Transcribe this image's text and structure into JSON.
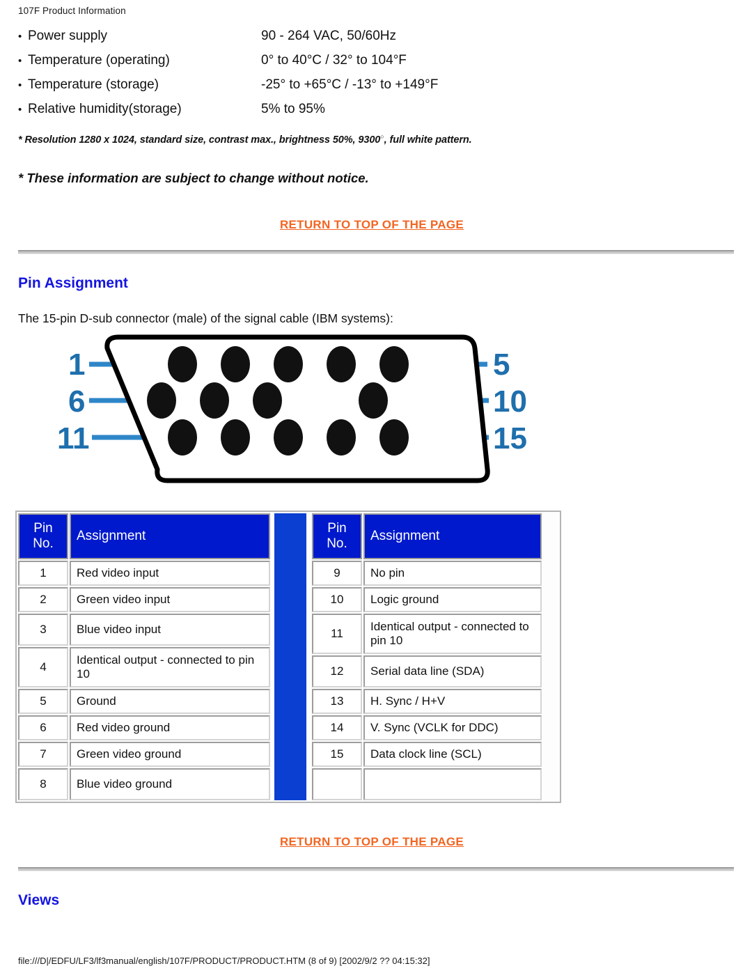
{
  "header": {
    "title": "107F Product Information"
  },
  "specs": {
    "bullet": "•",
    "rows": [
      {
        "label": "Power supply",
        "value": "90 - 264 VAC, 50/60Hz"
      },
      {
        "label": "Temperature (operating)",
        "value": "0° to 40°C / 32° to 104°F"
      },
      {
        "label": "Temperature (storage)",
        "value": "-25° to +65°C / -13° to +149°F"
      },
      {
        "label": "Relative humidity(storage)",
        "value": "5% to 95%"
      }
    ]
  },
  "footnotes": {
    "resolution_pre": "* Resolution 1280 x 1024, standard size, contrast max., brightness 50%, 9300",
    "resolution_sup": "○",
    "resolution_post": ", full white pattern.",
    "notice": "* These information are subject to change without notice."
  },
  "links": {
    "return_top_1": "RETURN TO TOP OF THE PAGE",
    "return_top_2": "RETURN TO TOP OF THE PAGE"
  },
  "sections": {
    "pin_assignment_title": "Pin Assignment",
    "pin_assignment_intro": "The 15-pin D-sub connector (male) of the signal cable (IBM systems):",
    "views_title": "Views"
  },
  "connector": {
    "labels": {
      "l1": "1",
      "l5": "5",
      "l6": "6",
      "l10": "10",
      "l11": "11",
      "l15": "15"
    },
    "label_color": "#1f6fad",
    "lead_color": "#2e86c8",
    "pin_color": "#111111",
    "shell_color": "#000000"
  },
  "table_left": {
    "header": {
      "no": "Pin\nNo.",
      "no_line1": "Pin",
      "no_line2": "No.",
      "assignment": "Assignment"
    },
    "rows": [
      {
        "no": "1",
        "assignment": "Red video input",
        "h": "h1"
      },
      {
        "no": "2",
        "assignment": "Green video input",
        "h": "h1"
      },
      {
        "no": "3",
        "assignment": "Blue video input",
        "h": "h3"
      },
      {
        "no": "4",
        "assignment": "Identical output - connected to pin 10",
        "h": "h2"
      },
      {
        "no": "5",
        "assignment": "Ground",
        "h": "h1"
      },
      {
        "no": "6",
        "assignment": "Red video ground",
        "h": "h1"
      },
      {
        "no": "7",
        "assignment": "Green video ground",
        "h": "h1"
      },
      {
        "no": "8",
        "assignment": "Blue video ground",
        "h": "h3"
      }
    ]
  },
  "table_right": {
    "header": {
      "no_line1": "Pin",
      "no_line2": "No.",
      "assignment": "Assignment"
    },
    "rows": [
      {
        "no": "9",
        "assignment": "No pin",
        "h": "h1"
      },
      {
        "no": "10",
        "assignment": "Logic ground",
        "h": "h1"
      },
      {
        "no": "11",
        "assignment": "Identical output - connected to pin 10",
        "h": "h2"
      },
      {
        "no": "12",
        "assignment": "Serial data line (SDA)",
        "h": "h3"
      },
      {
        "no": "13",
        "assignment": "H. Sync / H+V",
        "h": "h1"
      },
      {
        "no": "14",
        "assignment": "V. Sync (VCLK for DDC)",
        "h": "h1"
      },
      {
        "no": "15",
        "assignment": "Data clock line (SCL)",
        "h": "h1"
      },
      {
        "no": "",
        "assignment": "",
        "h": "h3"
      }
    ]
  },
  "colors": {
    "heading_blue": "#1414e0",
    "table_header_blue": "#0019cc",
    "divider_blue": "#0a3fd1",
    "link_orange": "#f26522"
  },
  "footer": {
    "path": "file:///D|/EDFU/LF3/lf3manual/english/107F/PRODUCT/PRODUCT.HTM (8 of 9) [2002/9/2 ?? 04:15:32]"
  }
}
